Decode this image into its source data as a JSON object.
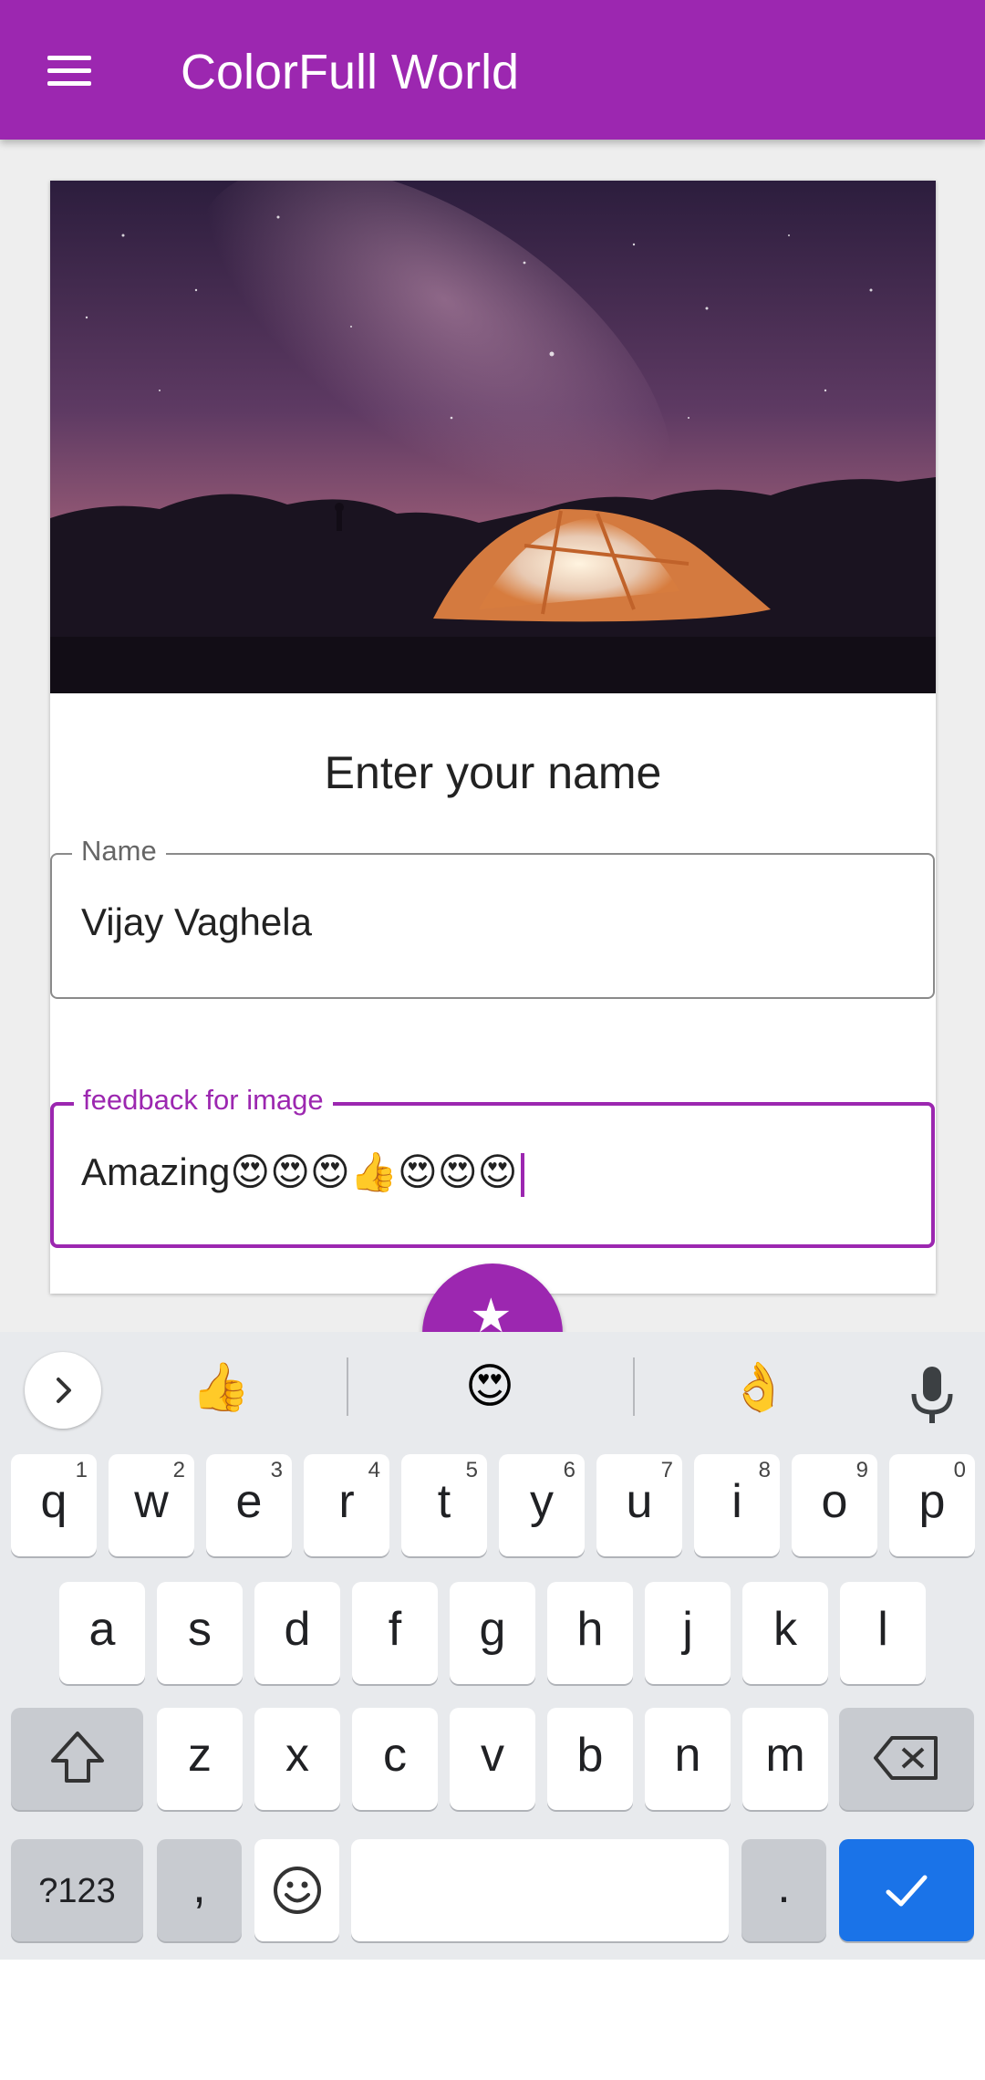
{
  "app": {
    "title": "ColorFull World",
    "brand_color": "#9c27b0"
  },
  "card": {
    "heading": "Enter your name"
  },
  "name_field": {
    "label": "Name",
    "value": "Vijay Vaghela"
  },
  "feedback_field": {
    "label": "feedback for image",
    "value": "Amazing😍😍😍👍😍😍😍"
  },
  "fab": {
    "icon": "star-icon"
  },
  "keyboard": {
    "suggestions": [
      "👍",
      "😍",
      "👌"
    ],
    "row1": [
      {
        "k": "q",
        "h": "1"
      },
      {
        "k": "w",
        "h": "2"
      },
      {
        "k": "e",
        "h": "3"
      },
      {
        "k": "r",
        "h": "4"
      },
      {
        "k": "t",
        "h": "5"
      },
      {
        "k": "y",
        "h": "6"
      },
      {
        "k": "u",
        "h": "7"
      },
      {
        "k": "i",
        "h": "8"
      },
      {
        "k": "o",
        "h": "9"
      },
      {
        "k": "p",
        "h": "0"
      }
    ],
    "row2": [
      "a",
      "s",
      "d",
      "f",
      "g",
      "h",
      "j",
      "k",
      "l"
    ],
    "row3": [
      "z",
      "x",
      "c",
      "v",
      "b",
      "n",
      "m"
    ],
    "symbols_label": "?123",
    "comma": ",",
    "period": ".",
    "accent": "#1a73e8"
  }
}
